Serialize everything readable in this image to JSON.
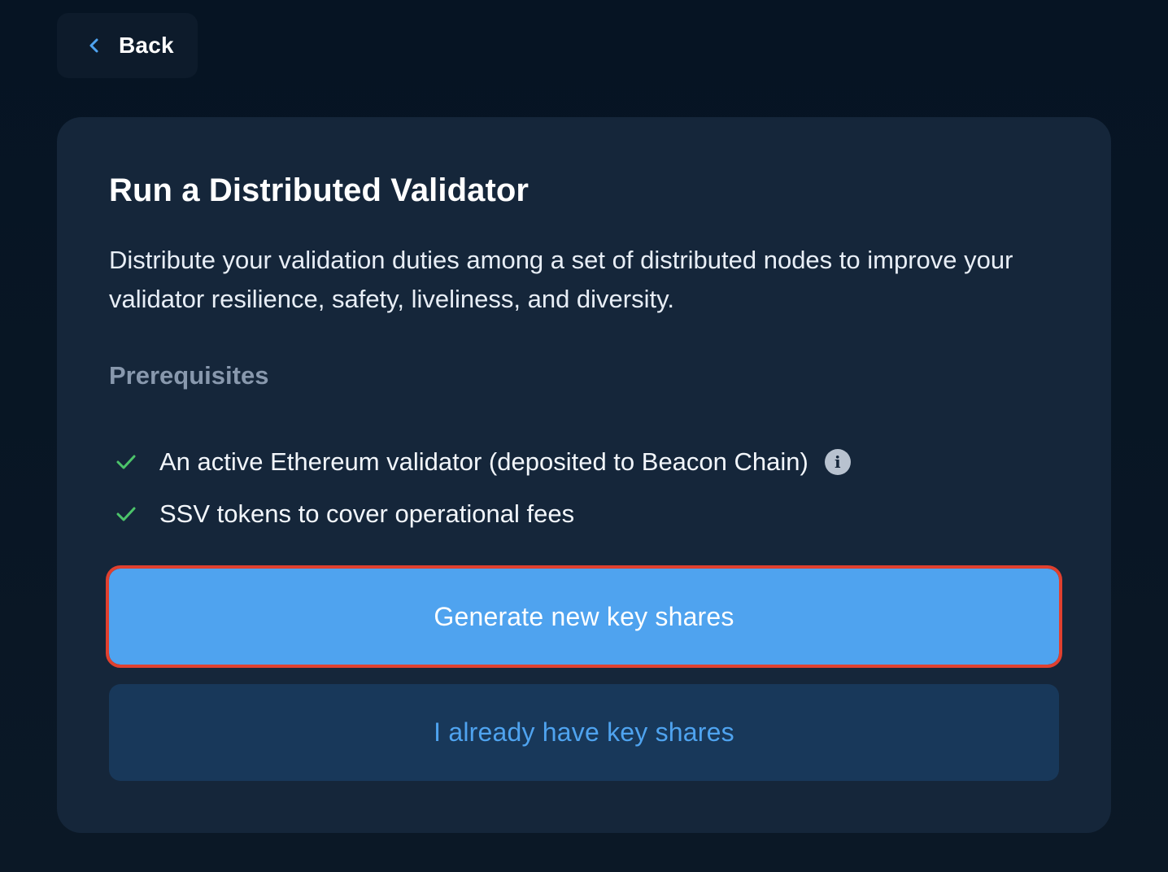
{
  "back": {
    "label": "Back"
  },
  "card": {
    "title": "Run a Distributed Validator",
    "description": "Distribute your validation duties among a set of distributed nodes to improve your validator resilience, safety, liveliness, and diversity.",
    "prerequisites_heading": "Prerequisites",
    "prerequisites": [
      {
        "text": "An active Ethereum validator (deposited to Beacon Chain)",
        "has_info": true
      },
      {
        "text": "SSV tokens to cover operational fees",
        "has_info": false
      }
    ],
    "primary_button": "Generate new key shares",
    "secondary_button": "I already have key shares"
  },
  "colors": {
    "background": "#061423",
    "card": "#15263a",
    "accent": "#4fa3ef",
    "secondary_button": "#18385a",
    "check": "#4cc46a",
    "highlight_border": "#e0402f"
  }
}
